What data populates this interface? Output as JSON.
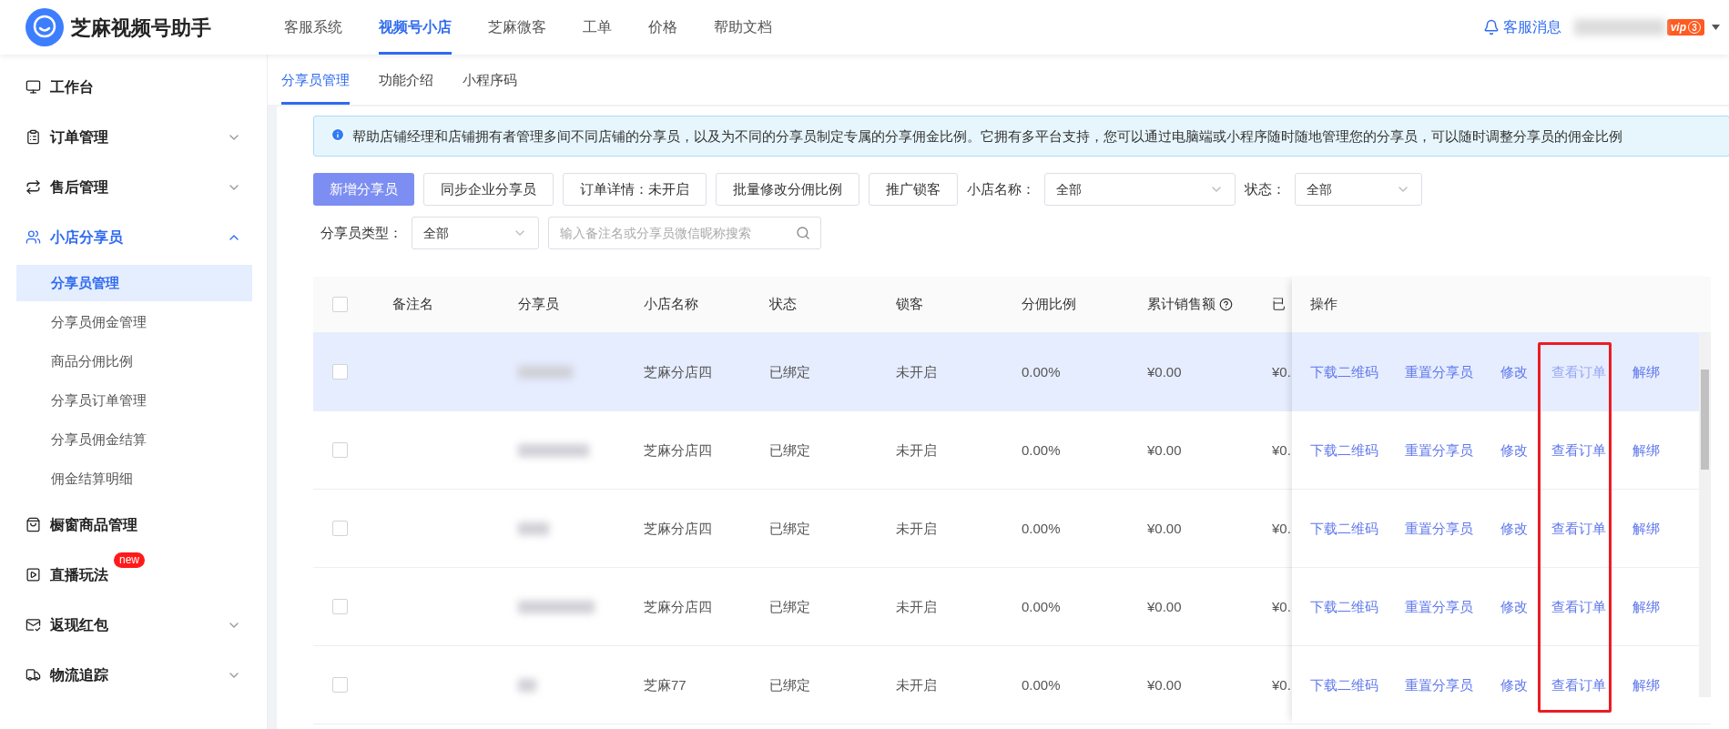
{
  "header": {
    "app_name": "芝麻视频号助手",
    "nav": [
      {
        "label": "客服系统",
        "selected": false
      },
      {
        "label": "视频号小店",
        "selected": true
      },
      {
        "label": "芝麻微客",
        "selected": false
      },
      {
        "label": "工单",
        "selected": false
      },
      {
        "label": "价格",
        "selected": false
      },
      {
        "label": "帮助文档",
        "selected": false
      }
    ],
    "messages": "客服消息",
    "vip_label": "vip",
    "vip_level": "3"
  },
  "sidebar": {
    "items": [
      {
        "label": "工作台",
        "selected": false
      },
      {
        "label": "订单管理",
        "selected": false,
        "expanded": false
      },
      {
        "label": "售后管理",
        "selected": false,
        "expanded": false
      },
      {
        "label": "小店分享员",
        "selected": true,
        "expanded": true,
        "children": [
          {
            "label": "分享员管理",
            "selected": true
          },
          {
            "label": "分享员佣金管理",
            "selected": false
          },
          {
            "label": "商品分佣比例",
            "selected": false
          },
          {
            "label": "分享员订单管理",
            "selected": false
          },
          {
            "label": "分享员佣金结算",
            "selected": false
          },
          {
            "label": "佣金结算明细",
            "selected": false
          }
        ]
      },
      {
        "label": "橱窗商品管理",
        "selected": false
      },
      {
        "label": "直播玩法",
        "selected": false,
        "badge": "new"
      },
      {
        "label": "返现红包",
        "selected": false,
        "expanded": false
      },
      {
        "label": "物流追踪",
        "selected": false,
        "expanded": false
      }
    ]
  },
  "tabs": [
    {
      "label": "分享员管理",
      "selected": true
    },
    {
      "label": "功能介绍",
      "selected": false
    },
    {
      "label": "小程序码",
      "selected": false
    }
  ],
  "notice": "帮助店铺经理和店铺拥有者管理多间不同店铺的分享员，以及为不同的分享员制定专属的分享佣金比例。它拥有多平台支持，您可以通过电脑端或小程序随时随地管理您的分享员，可以随时调整分享员的佣金比例",
  "toolbar": {
    "buttons": [
      {
        "label": "新增分享员",
        "kind": "primary"
      },
      {
        "label": "同步企业分享员",
        "kind": "default"
      },
      {
        "label": "订单详情：未开启",
        "kind": "default"
      },
      {
        "label": "批量修改分佣比例",
        "kind": "default"
      },
      {
        "label": "推广锁客",
        "kind": "default"
      }
    ],
    "filters": [
      {
        "label": "小店名称：",
        "value": "全部"
      },
      {
        "label": "状态：",
        "value": "全部"
      },
      {
        "label": "分享员类型：",
        "value": "全部"
      }
    ],
    "search": {
      "placeholder": "输入备注名或分享员微信昵称搜索"
    }
  },
  "table": {
    "select_all": {
      "checked": false
    },
    "columns": [
      {
        "label": "备注名"
      },
      {
        "label": "分享员"
      },
      {
        "label": "小店名称"
      },
      {
        "label": "状态"
      },
      {
        "label": "锁客"
      },
      {
        "label": "分佣比例"
      },
      {
        "label": "累计销售额",
        "help": true
      },
      {
        "label": "已"
      }
    ],
    "action_header": "操作",
    "rows": [
      {
        "checked": false,
        "highlighted": true,
        "shop": "芝麻分店四",
        "status": "已绑定",
        "lock": "未开启",
        "rate": "0.00%",
        "sales": "¥0.00",
        "column_8": "¥0.",
        "actions": [
          {
            "label": "下载二维码",
            "disabled": false,
            "boxed": false
          },
          {
            "label": "重置分享员",
            "disabled": false,
            "boxed": false
          },
          {
            "label": "修改",
            "disabled": false,
            "boxed": false
          },
          {
            "label": "查看订单",
            "disabled": true,
            "boxed": true
          },
          {
            "label": "解绑",
            "disabled": false,
            "boxed": false
          }
        ]
      },
      {
        "checked": false,
        "highlighted": false,
        "shop": "芝麻分店四",
        "status": "已绑定",
        "lock": "未开启",
        "rate": "0.00%",
        "sales": "¥0.00",
        "column_8": "¥0.",
        "actions": [
          {
            "label": "下载二维码",
            "disabled": false,
            "boxed": false
          },
          {
            "label": "重置分享员",
            "disabled": false,
            "boxed": false
          },
          {
            "label": "修改",
            "disabled": false,
            "boxed": false
          },
          {
            "label": "查看订单",
            "disabled": false,
            "boxed": true
          },
          {
            "label": "解绑",
            "disabled": false,
            "boxed": false
          }
        ]
      },
      {
        "checked": false,
        "highlighted": false,
        "shop": "芝麻分店四",
        "status": "已绑定",
        "lock": "未开启",
        "rate": "0.00%",
        "sales": "¥0.00",
        "column_8": "¥0.",
        "actions": [
          {
            "label": "下载二维码",
            "disabled": false,
            "boxed": false
          },
          {
            "label": "重置分享员",
            "disabled": false,
            "boxed": false
          },
          {
            "label": "修改",
            "disabled": false,
            "boxed": false
          },
          {
            "label": "查看订单",
            "disabled": false,
            "boxed": true
          },
          {
            "label": "解绑",
            "disabled": false,
            "boxed": false
          }
        ]
      },
      {
        "checked": false,
        "highlighted": false,
        "shop": "芝麻分店四",
        "status": "已绑定",
        "lock": "未开启",
        "rate": "0.00%",
        "sales": "¥0.00",
        "column_8": "¥0.",
        "actions": [
          {
            "label": "下载二维码",
            "disabled": false,
            "boxed": false
          },
          {
            "label": "重置分享员",
            "disabled": false,
            "boxed": false
          },
          {
            "label": "修改",
            "disabled": false,
            "boxed": false
          },
          {
            "label": "查看订单",
            "disabled": false,
            "boxed": true
          },
          {
            "label": "解绑",
            "disabled": false,
            "boxed": false
          }
        ]
      },
      {
        "checked": false,
        "highlighted": false,
        "shop": "芝麻77",
        "status": "已绑定",
        "lock": "未开启",
        "rate": "0.00%",
        "sales": "¥0.00",
        "column_8": "¥0.",
        "actions": [
          {
            "label": "下载二维码",
            "disabled": false,
            "boxed": false
          },
          {
            "label": "重置分享员",
            "disabled": false,
            "boxed": false
          },
          {
            "label": "修改",
            "disabled": false,
            "boxed": false
          },
          {
            "label": "查看订单",
            "disabled": false,
            "boxed": true
          },
          {
            "label": "解绑",
            "disabled": false,
            "boxed": false
          }
        ]
      }
    ]
  }
}
